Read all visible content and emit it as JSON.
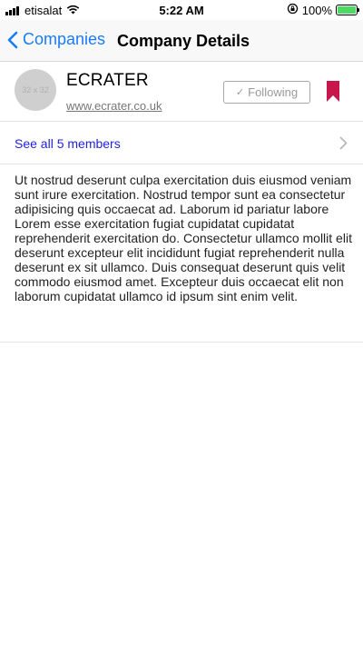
{
  "status_bar": {
    "carrier": "etisalat",
    "time": "5:22 AM",
    "battery_percent": "100%",
    "battery_level": 1.0,
    "icons": [
      "signal-bars-icon",
      "wifi-icon",
      "orientation-lock-icon",
      "battery-icon"
    ]
  },
  "nav": {
    "back_label": "Companies",
    "title": "Company Details"
  },
  "company": {
    "logo_placeholder": "32 x 32",
    "name": "ECRATER",
    "url": "www.ecrater.co.uk",
    "follow_label": "Following",
    "bookmark_color": "#c8174d"
  },
  "members": {
    "label": "See all 5 members"
  },
  "description": "Ut nostrud deserunt culpa exercitation duis eiusmod veniam sunt irure exercitation. Nostrud tempor sunt ea consectetur adipisicing quis occaecat ad. Laborum id pariatur labore Lorem esse exercitation fugiat cupidatat cupidatat reprehenderit exercitation do. Consectetur ullamco mollit elit deserunt excepteur elit incididunt fugiat reprehenderit nulla deserunt ex sit ullamco. Duis consequat deserunt quis velit commodo eiusmod amet. Excepteur duis occaecat elit non laborum cupidatat ullamco id ipsum sint enim velit.",
  "colors": {
    "accent": "#1a7cf5",
    "link": "#2222dd",
    "battery": "#4cd964"
  }
}
